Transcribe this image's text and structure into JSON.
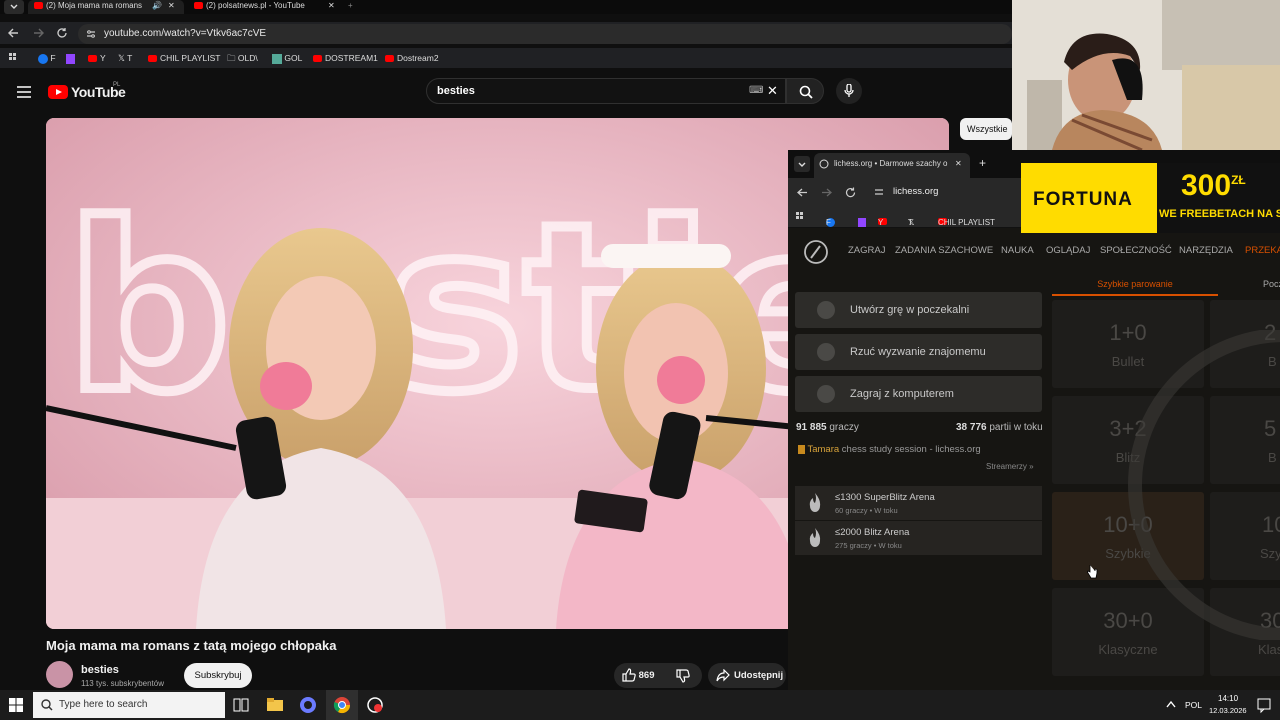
{
  "browser": {
    "tabs": [
      {
        "title": "(2) Moja mama ma romans",
        "active": true
      },
      {
        "title": "(2) polsatnews.pl - YouTube",
        "active": false
      }
    ],
    "url": "youtube.com/watch?v=Vtkv6ac7cVE",
    "bookmarks": [
      "F",
      "Y",
      "T",
      "CHIL PLAYLIST",
      "OLD\\",
      "GOL",
      "DOSTREAM1",
      "Dostream2"
    ]
  },
  "youtube": {
    "logo": "YouTube",
    "region": "PL",
    "search_value": "besties",
    "video": {
      "title": "Moja mama ma romans z tatą mojego chłopaka",
      "neon_text": "besties"
    },
    "channel": {
      "name": "besties",
      "subscribers": "113 tys. subskrybentów"
    },
    "subscribe_label": "Subskrybuj",
    "likes": "869",
    "share_label": "Udostępnij",
    "chip_label": "Wszystkie"
  },
  "lichess": {
    "tab_title": "lichess.org • Darmowe szachy o",
    "url": "lichess.org",
    "bookmarks": [
      "F",
      "Y",
      "T",
      "CHIL PLAYLIST"
    ],
    "nav": [
      "ZAGRAJ",
      "ZADANIA SZACHOWE",
      "NAUKA",
      "OGLĄDAJ",
      "SPOŁECZNOŚĆ",
      "NARZĘDZIA",
      "PRZEKA"
    ],
    "buttons": [
      "Utwórz grę w poczekalni",
      "Rzuć wyzwanie znajomemu",
      "Zagraj z komputerem"
    ],
    "players_count": "91 885",
    "players_label": "graczy",
    "games_count": "38 776",
    "games_label": "partii w toku",
    "streamer_name": "Tamara",
    "streamer_title": "chess study session - lichess.org",
    "streamers_link": "Streamerzy »",
    "tournaments": [
      {
        "name": "≤1300 SuperBlitz Arena",
        "info": "60 graczy • W toku"
      },
      {
        "name": "≤2000 Blitz Arena",
        "info": "275 graczy • W toku"
      }
    ],
    "pairing_tabs": [
      "Szybkie parowanie",
      "Pocz"
    ],
    "pools": [
      {
        "time": "1+0",
        "name": "Bullet"
      },
      {
        "time": "3+2",
        "name": "Blitz"
      },
      {
        "time": "10+0",
        "name": "Szybkie"
      },
      {
        "time": "30+0",
        "name": "Klasyczne"
      }
    ],
    "pools_right": [
      {
        "time": "2",
        "name": "B"
      },
      {
        "time": "5",
        "name": "B"
      },
      {
        "time": "10",
        "name": "Szy"
      },
      {
        "time": "30",
        "name": "Klas"
      }
    ]
  },
  "ad": {
    "brand": "FORTUNA",
    "amount": "300",
    "currency": "ZŁ",
    "tagline": "WE FREEBETACH NA STAR"
  },
  "taskbar": {
    "search_placeholder": "Type here to search",
    "lang": "POL",
    "time": "14:10",
    "date": "12.03.2026"
  },
  "colors": {
    "yt_red": "#ff0000",
    "lichess_orange": "#d85000",
    "fortuna_yellow": "#ffdc00"
  }
}
